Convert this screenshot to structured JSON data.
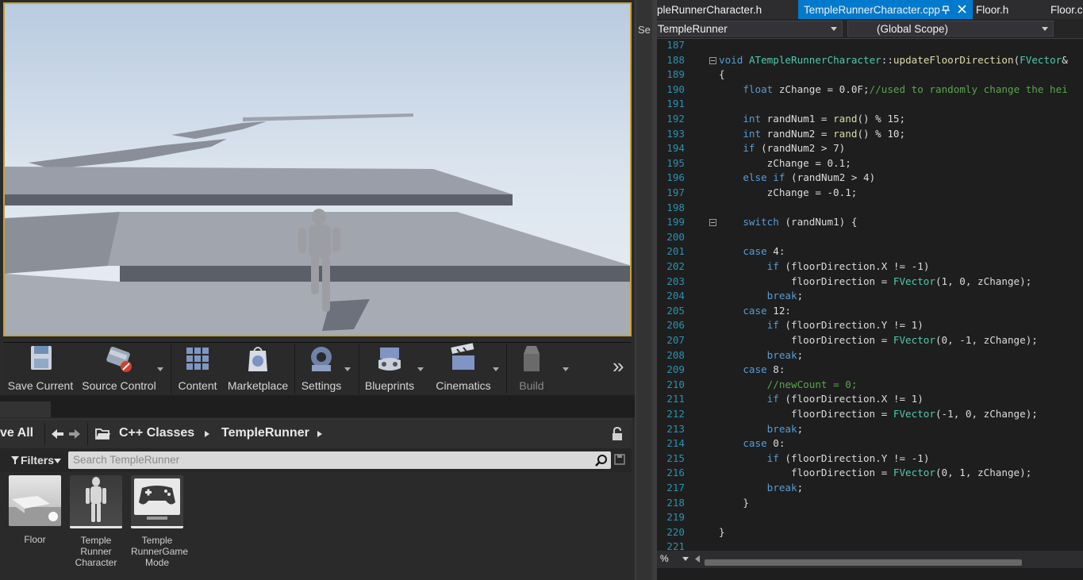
{
  "toolbar": {
    "buttons": [
      {
        "label": "Save Current",
        "icon": "save-icon"
      },
      {
        "label": "Source Control",
        "icon": "source-control-icon"
      },
      {
        "label": "Content",
        "icon": "content-icon"
      },
      {
        "label": "Marketplace",
        "icon": "marketplace-icon"
      },
      {
        "label": "Settings",
        "icon": "settings-icon"
      },
      {
        "label": "Blueprints",
        "icon": "blueprints-icon"
      },
      {
        "label": "Cinematics",
        "icon": "cinematics-icon"
      },
      {
        "label": "Build",
        "icon": "build-icon"
      }
    ],
    "more": "»"
  },
  "content_browser": {
    "save_all": "ve All",
    "path": [
      "C++ Classes",
      "TempleRunner"
    ],
    "filters": "Filters",
    "search_placeholder": "Search TempleRunner",
    "assets": [
      {
        "label": "Floor"
      },
      {
        "label": "Temple Runner Character"
      },
      {
        "label": "Temple RunnerGame Mode"
      }
    ]
  },
  "splitter_label": "Se",
  "editor": {
    "tabs": [
      {
        "label": "pleRunnerCharacter.h",
        "active": false
      },
      {
        "label": "TempleRunnerCharacter.cpp",
        "active": true
      },
      {
        "label": "Floor.h",
        "active": false
      },
      {
        "label": "Floor.c",
        "active": false
      }
    ],
    "nav_project": "TempleRunner",
    "nav_scope": "(Global Scope)",
    "zoom": "%",
    "lines": [
      {
        "n": "187",
        "t": ""
      },
      {
        "n": "188",
        "t": "void ATempleRunnerCharacter::updateFloorDirection(FVector&"
      },
      {
        "n": "189",
        "t": "{"
      },
      {
        "n": "190",
        "t": "    float zChange = 0.0F;//used to randomly change the hei"
      },
      {
        "n": "191",
        "t": ""
      },
      {
        "n": "192",
        "t": "    int randNum1 = rand() % 15;"
      },
      {
        "n": "193",
        "t": "    int randNum2 = rand() % 10;"
      },
      {
        "n": "194",
        "t": "    if (randNum2 > 7)"
      },
      {
        "n": "195",
        "t": "        zChange = 0.1;"
      },
      {
        "n": "196",
        "t": "    else if (randNum2 > 4)"
      },
      {
        "n": "197",
        "t": "        zChange = -0.1;"
      },
      {
        "n": "198",
        "t": ""
      },
      {
        "n": "199",
        "t": "    switch (randNum1) {"
      },
      {
        "n": "200",
        "t": ""
      },
      {
        "n": "201",
        "t": "    case 4:"
      },
      {
        "n": "202",
        "t": "        if (floorDirection.X != -1)"
      },
      {
        "n": "203",
        "t": "            floorDirection = FVector(1, 0, zChange);"
      },
      {
        "n": "204",
        "t": "        break;"
      },
      {
        "n": "205",
        "t": "    case 12:"
      },
      {
        "n": "206",
        "t": "        if (floorDirection.Y != 1)"
      },
      {
        "n": "207",
        "t": "            floorDirection = FVector(0, -1, zChange);"
      },
      {
        "n": "208",
        "t": "        break;"
      },
      {
        "n": "209",
        "t": "    case 8:"
      },
      {
        "n": "210",
        "t": "        //newCount = 0;"
      },
      {
        "n": "211",
        "t": "        if (floorDirection.X != 1)"
      },
      {
        "n": "212",
        "t": "            floorDirection = FVector(-1, 0, zChange);"
      },
      {
        "n": "213",
        "t": "        break;"
      },
      {
        "n": "214",
        "t": "    case 0:"
      },
      {
        "n": "215",
        "t": "        if (floorDirection.Y != -1)"
      },
      {
        "n": "216",
        "t": "            floorDirection = FVector(0, 1, zChange);"
      },
      {
        "n": "217",
        "t": "        break;"
      },
      {
        "n": "218",
        "t": "    }"
      },
      {
        "n": "219",
        "t": ""
      },
      {
        "n": "220",
        "t": "}"
      },
      {
        "n": "221",
        "t": ""
      }
    ]
  },
  "colors": {
    "accent_tab": "#007acc",
    "viewport_border": "#c8a23a",
    "keyword": "#569cd6",
    "comment": "#57a64a",
    "type": "#4ec9b0",
    "line_number": "#2b91af"
  }
}
